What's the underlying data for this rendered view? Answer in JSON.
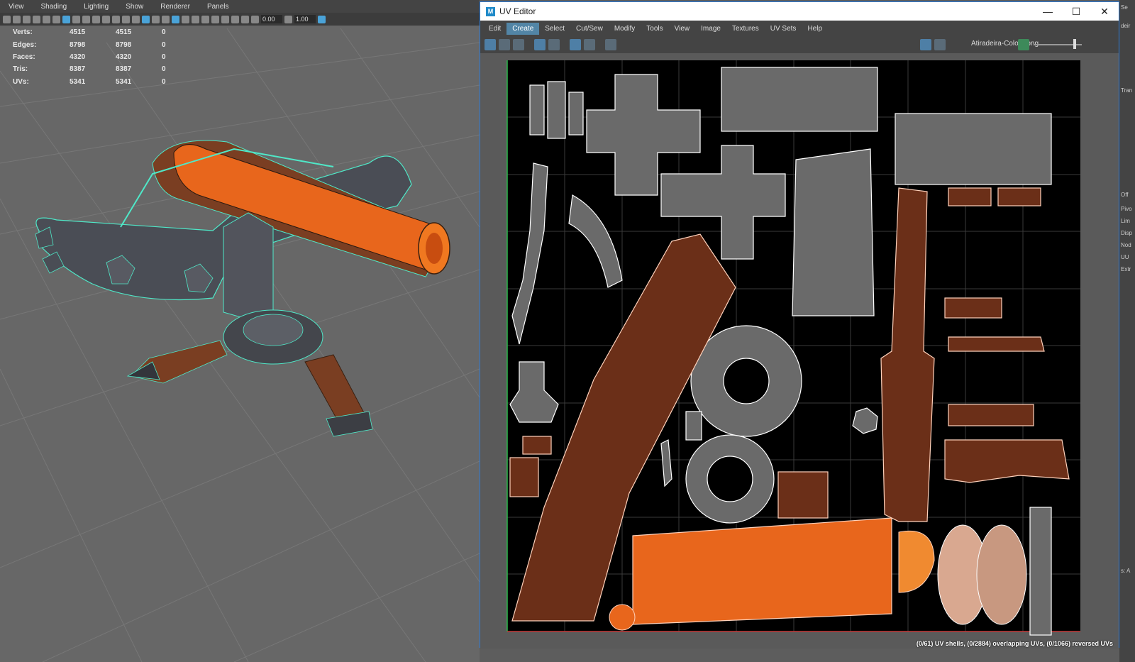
{
  "viewport": {
    "menu": [
      "View",
      "Shading",
      "Lighting",
      "Show",
      "Renderer",
      "Panels"
    ],
    "toolbar_fields": [
      "0.00",
      "1.00"
    ],
    "hud": [
      {
        "label": "Verts:",
        "a": "4515",
        "b": "4515",
        "c": "0"
      },
      {
        "label": "Edges:",
        "a": "8798",
        "b": "8798",
        "c": "0"
      },
      {
        "label": "Faces:",
        "a": "4320",
        "b": "4320",
        "c": "0"
      },
      {
        "label": "Tris:",
        "a": "8387",
        "b": "8387",
        "c": "0"
      },
      {
        "label": "UVs:",
        "a": "5341",
        "b": "5341",
        "c": "0"
      }
    ]
  },
  "uv_editor": {
    "title": "UV Editor",
    "app_icon": "M",
    "menu": [
      "Edit",
      "Create",
      "Select",
      "Cut/Sew",
      "Modify",
      "Tools",
      "View",
      "Image",
      "Textures",
      "UV Sets",
      "Help"
    ],
    "active_menu": "Create",
    "texture": "Atiradeira-Color1.png",
    "status": "(0/61) UV shells, (0/2884) overlapping UVs, (0/1066) reversed UVs"
  },
  "right_panel": {
    "labels": [
      "Se",
      "deir",
      "Tran",
      "Off",
      "Pivo",
      "Lim",
      "Disp",
      "Nod",
      "UU",
      "Extr",
      "s: A"
    ]
  },
  "colors": {
    "accent": "#5285a6",
    "wire_cyan": "#4fe8c8",
    "wood_orange": "#e8661c",
    "uv_bg": "#000000"
  }
}
